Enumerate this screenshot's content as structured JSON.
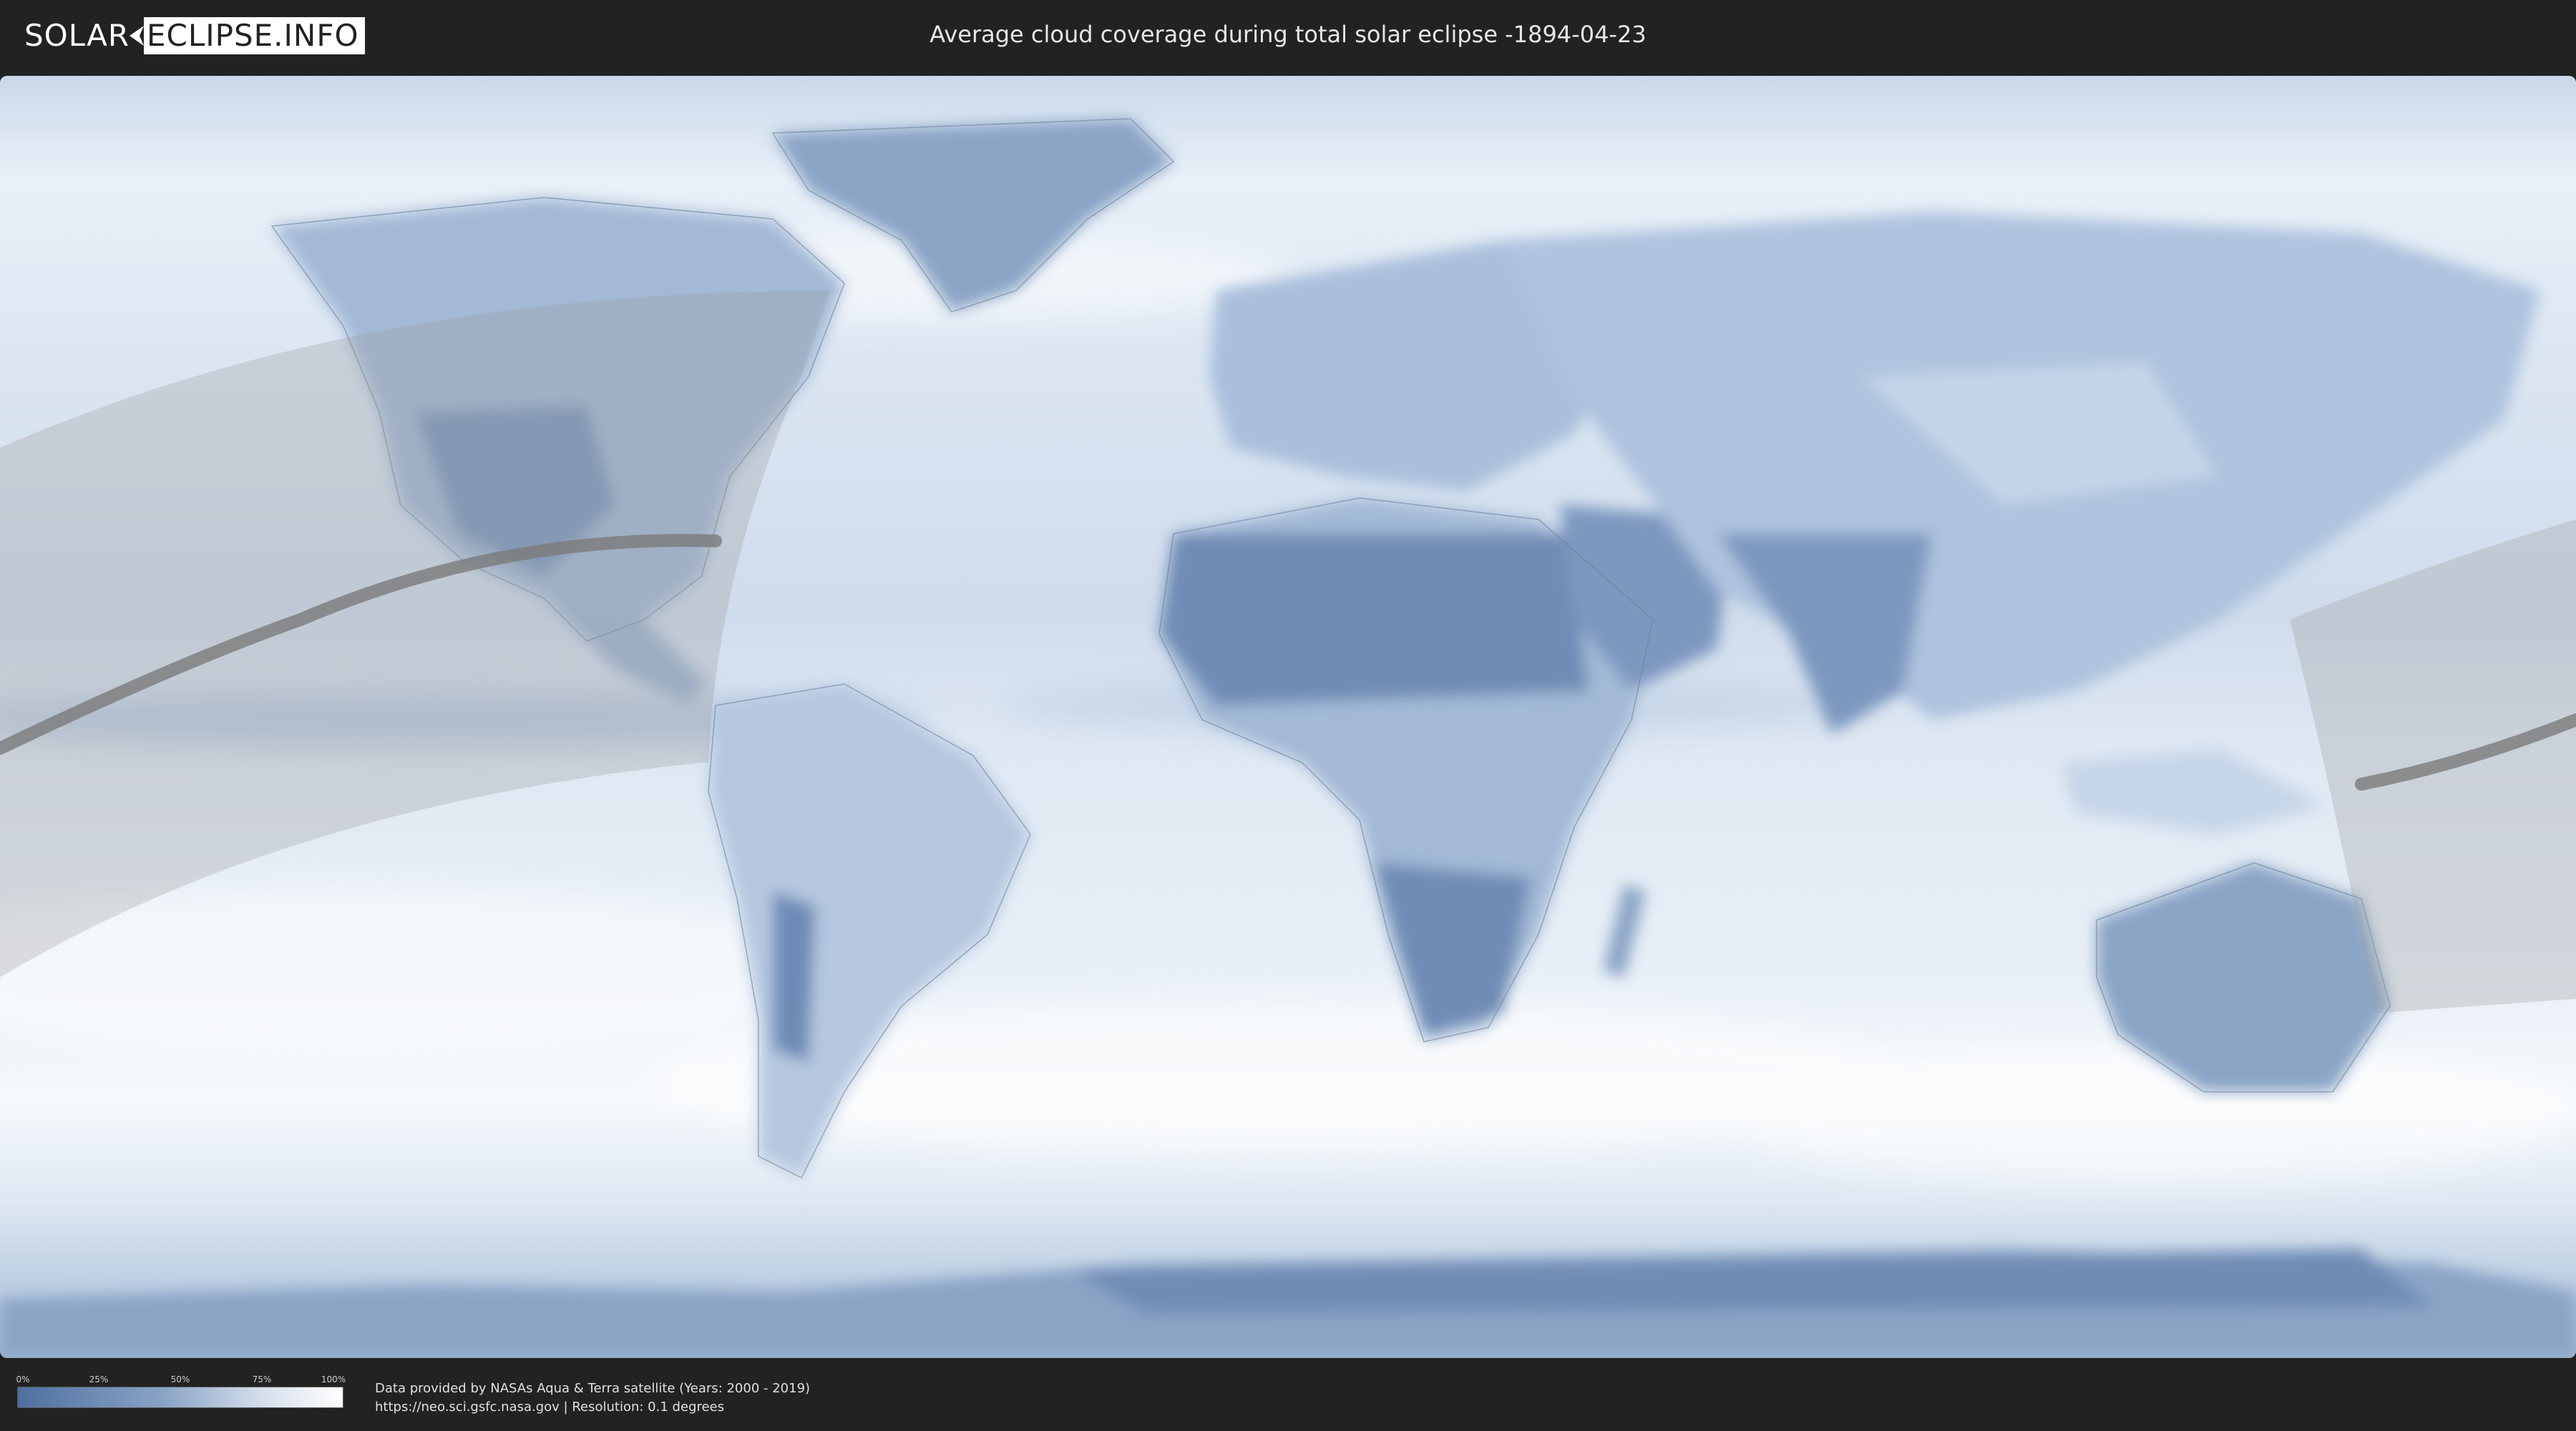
{
  "header": {
    "logo_part1": "SOLAR",
    "logo_part2": "ECLIPSE.INFO",
    "title": "Average cloud coverage during total solar eclipse -1894-04-23"
  },
  "map": {
    "layer": "average cloud coverage",
    "projection": "equirectangular world map",
    "eclipse_path": "total solar eclipse central line with penumbral shading",
    "colors": {
      "clear_sky": "#4f6f9f",
      "full_cloud": "#ffffff",
      "ocean_base": "#dbe6f2",
      "eclipse_path": "#7a7a7a"
    }
  },
  "legend": {
    "ticks": [
      "0%",
      "25%",
      "50%",
      "75%",
      "100%"
    ]
  },
  "credits": {
    "line1": "Data provided by NASAs Aqua & Terra satellite (Years: 2000 - 2019)",
    "line2": "https://neo.sci.gsfc.nasa.gov | Resolution: 0.1 degrees"
  }
}
